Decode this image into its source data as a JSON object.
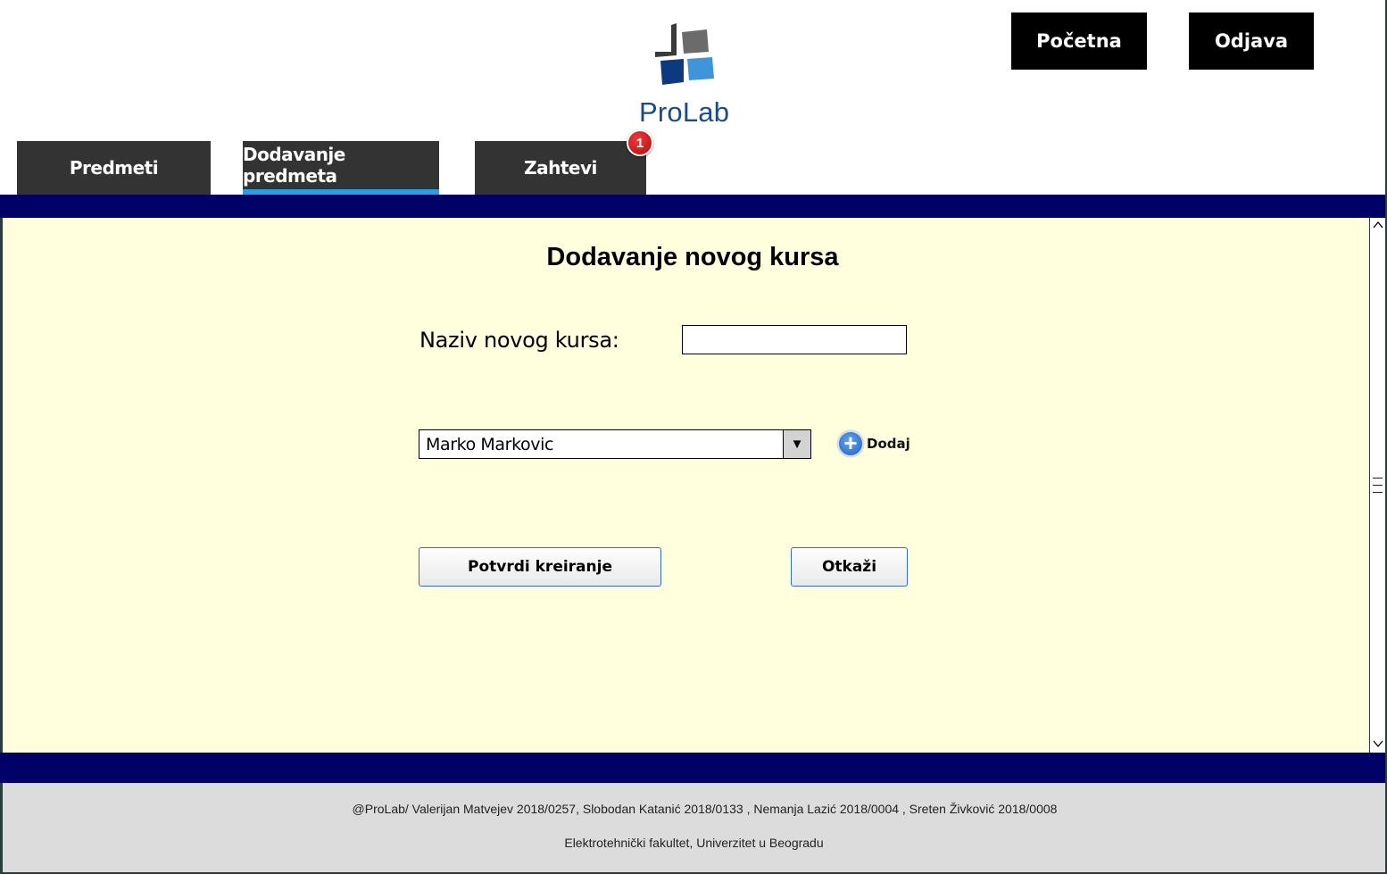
{
  "header": {
    "logo_text": "ProLab",
    "home_label": "Početna",
    "logout_label": "Odjava"
  },
  "tabs": [
    {
      "label": "Predmeti",
      "active": false
    },
    {
      "label": "Dodavanje predmeta",
      "active": true
    },
    {
      "label": "Zahtevi",
      "active": false,
      "badge": "1"
    }
  ],
  "form": {
    "title": "Dodavanje novog kursa",
    "name_label": "Naziv novog kursa:",
    "name_value": "",
    "professor_select_value": "Marko Markovic",
    "add_label": "Dodaj",
    "confirm_label": "Potvrdi kreiranje",
    "cancel_label": "Otkaži"
  },
  "footer": {
    "line1": "@ProLab/ Valerijan Matvejev 2018/0257, Slobodan Katanić 2018/0133 , Nemanja Lazić 2018/0004 , Sreten Živković 2018/0008",
    "line2": "Elektrotehnički fakultet, Univerzitet u Beogradu"
  },
  "colors": {
    "band": "#000066",
    "content_bg": "#ffffdd",
    "tab_bg": "#333333",
    "active_tab_underline": "#2a9fe0",
    "footer_bg": "#dcdcdc",
    "logo_text": "#1b4a8a",
    "badge": "#c81414"
  },
  "icons": {
    "logo": "prolab-logo-icon",
    "add": "plus-circle-icon",
    "dropdown": "dropdown-arrow-icon",
    "scroll_up": "chevron-up-icon",
    "scroll_down": "chevron-down-icon"
  }
}
